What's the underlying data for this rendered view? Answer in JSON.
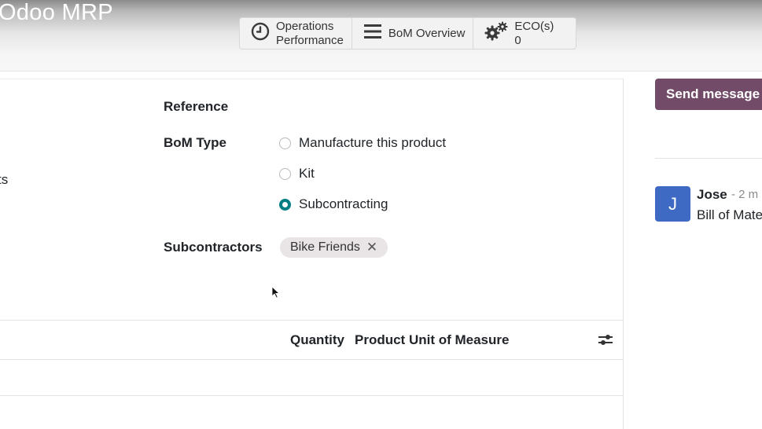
{
  "header": {
    "app_title": "Odoo MRP",
    "smart_buttons": [
      {
        "icon": "clock-icon",
        "line1": "Operations",
        "line2": "Performance"
      },
      {
        "icon": "list-icon",
        "label": "BoM Overview"
      },
      {
        "icon": "gears-icon",
        "line1": "ECO(s)",
        "line2": "0"
      }
    ]
  },
  "form": {
    "left_fragment": "ts",
    "reference_label": "Reference",
    "bom_type_label": "BoM Type",
    "bom_type_options": [
      {
        "label": "Manufacture this product",
        "checked": false
      },
      {
        "label": "Kit",
        "checked": false
      },
      {
        "label": "Subcontracting",
        "checked": true
      }
    ],
    "subcontractors_label": "Subcontractors",
    "subcontractor_tags": [
      "Bike Friends"
    ],
    "remove_symbol": "✕"
  },
  "components_table": {
    "columns": [
      "Quantity",
      "Product Unit of Measure"
    ]
  },
  "chatter": {
    "send_message_label": "Send message",
    "message": {
      "avatar_initial": "J",
      "author": "Jose",
      "time": "- 2 m",
      "body": "Bill of Mate"
    }
  },
  "colors": {
    "primary": "#714b67",
    "radio_checked": "#017e84",
    "avatar": "#3f6ac4",
    "tag_bg": "#e9e4e6"
  }
}
